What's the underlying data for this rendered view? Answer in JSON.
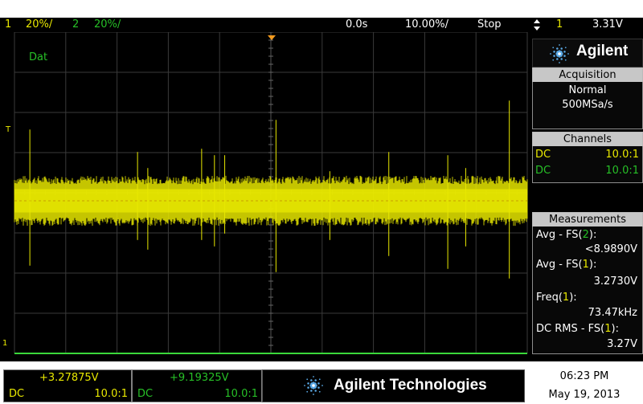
{
  "top_bar": {
    "ch1_num": "1",
    "ch1_scale": "20%/",
    "ch2_num": "2",
    "ch2_scale": "20%/",
    "time_offset": "0.0s",
    "time_scale": "10.00%/",
    "run_state": "Stop",
    "trigger_source": "1",
    "trigger_level": "3.31V",
    "trigger_icon": "trigger-edge-icon"
  },
  "screen": {
    "dat_label": "Dat",
    "trigger_marker": "T",
    "ground_marker": "1",
    "trace": {
      "channel": "1",
      "color": "#e8e800",
      "level_fraction_from_top": 0.525,
      "band_fraction": 0.104,
      "spikes_fraction": [
        {
          "time_div": 0.3,
          "high": 0.17,
          "low": 0.15
        },
        {
          "time_div": 2.4,
          "high": 0.1,
          "low": 0.07
        },
        {
          "time_div": 2.6,
          "high": 0.05,
          "low": 0.1
        },
        {
          "time_div": 3.65,
          "high": 0.11,
          "low": 0.07
        },
        {
          "time_div": 3.9,
          "high": 0.09,
          "low": 0.09
        },
        {
          "time_div": 4.1,
          "high": 0.09,
          "low": 0.05
        },
        {
          "time_div": 5.1,
          "high": 0.2,
          "low": 0.17
        },
        {
          "time_div": 6.15,
          "high": 0.04,
          "low": 0.07
        },
        {
          "time_div": 7.3,
          "high": 0.1,
          "low": 0.12
        },
        {
          "time_div": 8.45,
          "high": 0.09,
          "low": 0.16
        },
        {
          "time_div": 8.8,
          "high": 0.05,
          "low": 0.09
        },
        {
          "time_div": 9.65,
          "high": 0.26,
          "low": 0.19
        }
      ]
    },
    "grid_color": "#3a3a3a",
    "ground_line_color": "#3ad83a"
  },
  "panel": {
    "brand": "Agilent",
    "logo_icon": "agilent-spark-icon",
    "acquisition": {
      "header": "Acquisition",
      "mode": "Normal",
      "rate": "500MSa/s"
    },
    "channels": {
      "header": "Channels",
      "rows": [
        {
          "coupling": "DC",
          "probe": "10.0:1",
          "color": "#e8e800"
        },
        {
          "coupling": "DC",
          "probe": "10.0:1",
          "color": "#27c027"
        }
      ]
    },
    "measurements": {
      "header": "Measurements",
      "items": [
        {
          "name": "Avg - FS(",
          "src": "2",
          "close": "):",
          "value": "<8.9890V",
          "src_color": "#27c027"
        },
        {
          "name": "Avg - FS(",
          "src": "1",
          "close": "):",
          "value": "3.2730V",
          "src_color": "#e8e800"
        },
        {
          "name": "Freq(",
          "src": "1",
          "close": "):",
          "value": "73.47kHz",
          "src_color": "#e8e800"
        },
        {
          "name": "DC RMS - FS(",
          "src": "1",
          "close": "):",
          "value": "3.27V",
          "src_color": "#e8e800"
        }
      ]
    }
  },
  "bottom": {
    "ch1_offset": "+3.27875V",
    "ch1_coupling": "DC",
    "ch1_probe": "10.0:1",
    "ch2_offset": "+9.19325V",
    "ch2_coupling": "DC",
    "ch2_probe": "10.0:1",
    "company": "Agilent Technologies",
    "time": "06:23 PM",
    "date": "May 19, 2013"
  }
}
